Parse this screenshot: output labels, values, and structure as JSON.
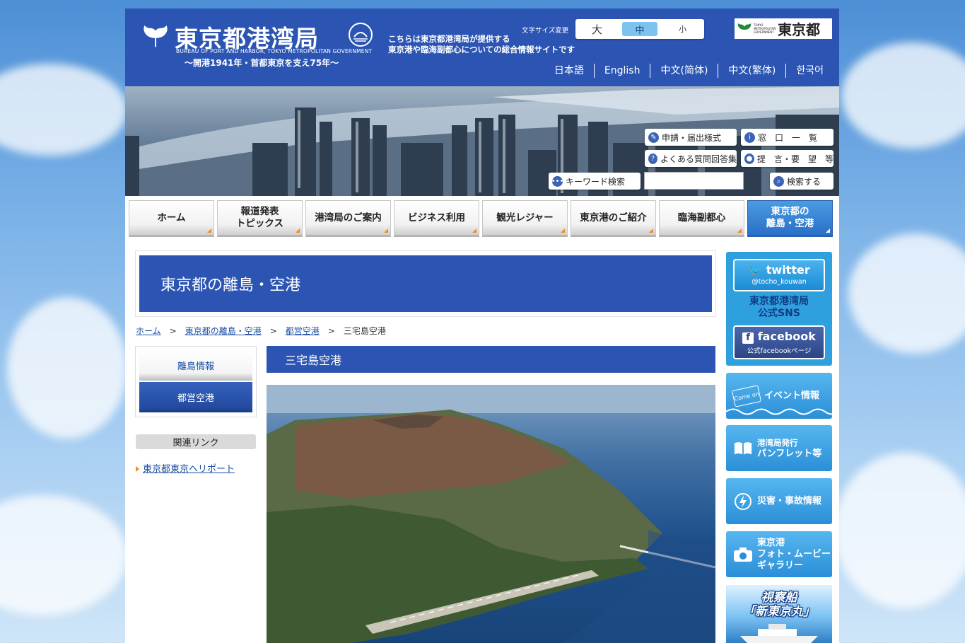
{
  "header": {
    "logo_title": "東京都港湾局",
    "logo_en": "BUREAU OF PORT AND HARBOR, TOKYO METROPOLITAN GOVERNMENT",
    "logo_sub": "〜開港1941年・首都東京を支え75年〜",
    "description_line1": "こちらは東京都港湾局が提供する",
    "description_line2": "東京港や臨海副都心についての総合情報サイトです",
    "font_size_label": "文字サイズ変更",
    "font_sizes": {
      "large": "大",
      "medium": "中",
      "small": "小"
    },
    "metro_logo_small": "TOKYO METROPOLITAN GOVERNMENT",
    "metro_logo_text": "東京都",
    "languages": [
      "日本語",
      "English",
      "中文(简体)",
      "中文(繁体)",
      "한국어"
    ]
  },
  "hero": {
    "buttons": {
      "forms": "申請・届出様式",
      "windows": "窓　口　一　覧",
      "faq": "よくある質問回答集",
      "proposals": "提　言・要　望　等",
      "keyword": "キーワード検索",
      "search": "検索する"
    },
    "search_value": ""
  },
  "nav": [
    {
      "line1": "ホーム",
      "line2": ""
    },
    {
      "line1": "報道発表",
      "line2": "トピックス"
    },
    {
      "line1": "港湾局のご案内",
      "line2": ""
    },
    {
      "line1": "ビジネス利用",
      "line2": ""
    },
    {
      "line1": "観光レジャー",
      "line2": ""
    },
    {
      "line1": "東京港のご紹介",
      "line2": ""
    },
    {
      "line1": "臨海副都心",
      "line2": ""
    },
    {
      "line1": "東京都の",
      "line2": "離島・空港"
    }
  ],
  "page": {
    "title": "東京都の離島・空港",
    "breadcrumb": [
      "ホーム",
      "東京都の離島・空港",
      "都営空港",
      "三宅島空港"
    ],
    "breadcrumb_sep": ">",
    "section_title": "三宅島空港"
  },
  "sidebar": {
    "items": [
      "離島情報",
      "都営空港"
    ],
    "related_heading": "関連リンク",
    "related_links": [
      "東京都東京ヘリポート"
    ]
  },
  "right": {
    "twitter_label": "twitter",
    "twitter_handle": "@tocho_kouwan",
    "sns_title_line1": "東京都港湾局",
    "sns_title_line2": "公式SNS",
    "facebook_label": "facebook",
    "facebook_sub": "公式facebookページ",
    "banners": [
      {
        "line1": "イベント情報",
        "line2": "",
        "badge": "Come on"
      },
      {
        "line1": "港湾局発行",
        "line2": "パンフレット等"
      },
      {
        "line1": "災害・事故情報",
        "line2": ""
      },
      {
        "line1": "東京港",
        "line2": "フォト・ムービー",
        "line3": "ギャラリー"
      }
    ],
    "ship_banner_line1": "視察船",
    "ship_banner_line2": "「新東京丸」"
  },
  "colors": {
    "header_blue": "#2c55b3",
    "accent_orange": "#f08d1e",
    "nav_active": "#2a6fc9",
    "banner_blue": "#2b8fd8"
  }
}
